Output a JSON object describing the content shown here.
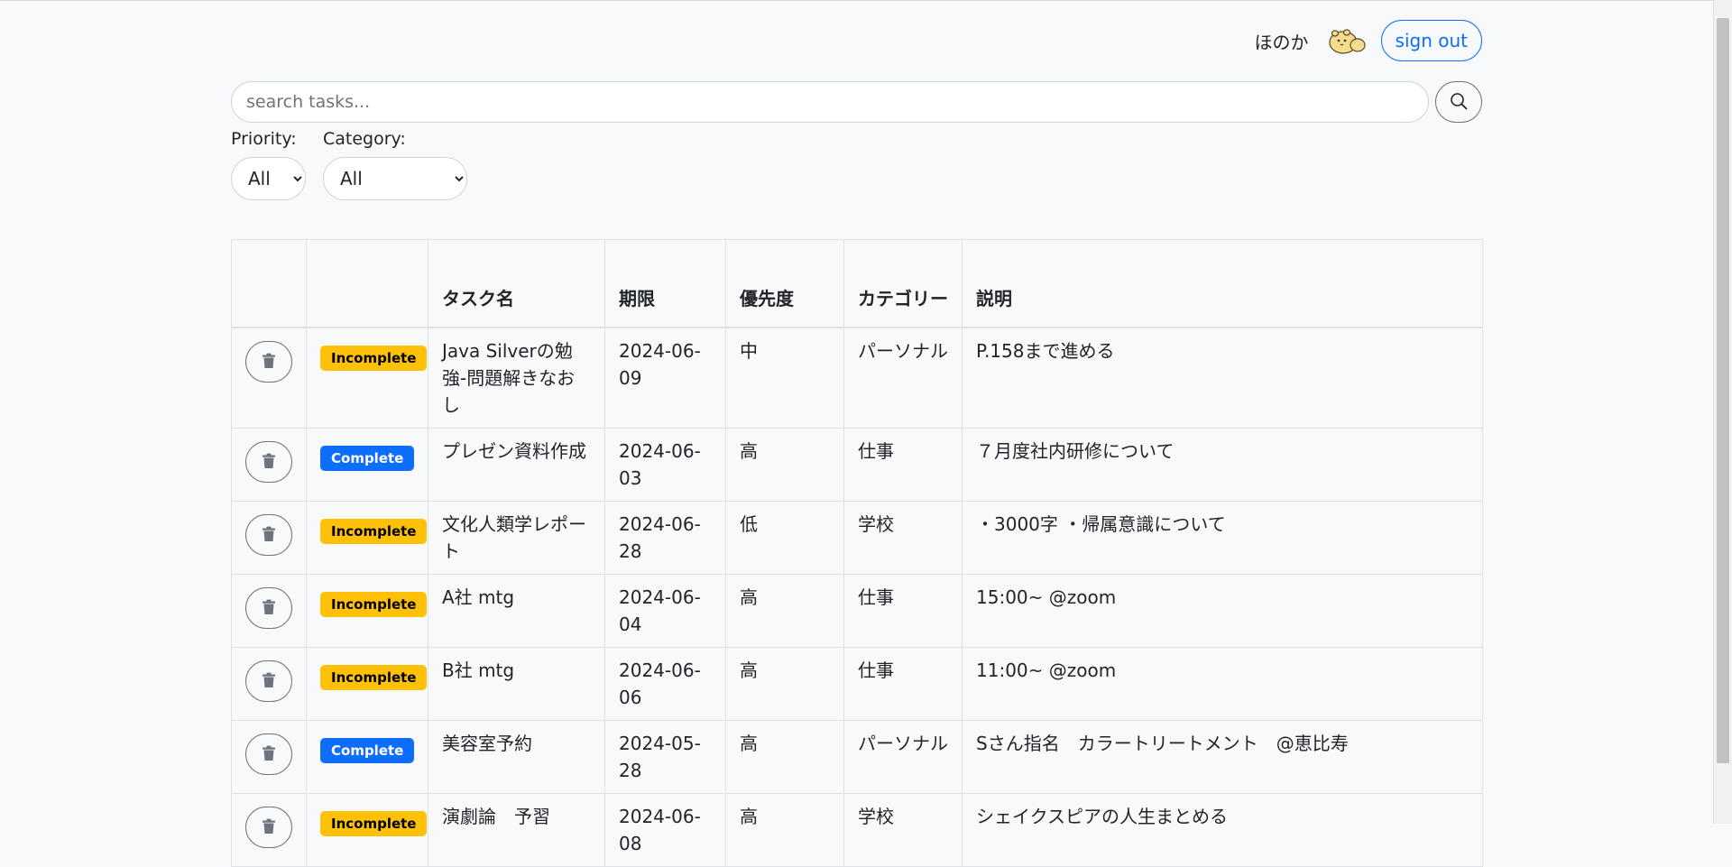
{
  "header": {
    "user_name": "ほのか",
    "avatar_icon": "hamster-avatar-icon",
    "sign_out_label": "sign out"
  },
  "search": {
    "placeholder": "search tasks...",
    "value": "",
    "button_icon": "search-icon"
  },
  "filters": {
    "priority": {
      "label": "Priority:",
      "selected": "All"
    },
    "category": {
      "label": "Category:",
      "selected": "All"
    }
  },
  "table": {
    "columns": [
      "",
      "",
      "タスク名",
      "期限",
      "優先度",
      "カテゴリー",
      "説明"
    ],
    "rows": [
      {
        "status": "Incomplete",
        "name": "Java Silverの勉強-問題解きなおし",
        "deadline": "2024-06-09",
        "priority": "中",
        "category": "パーソナル",
        "description": "P.158まで進める"
      },
      {
        "status": "Complete",
        "name": "プレゼン資料作成",
        "deadline": "2024-06-03",
        "priority": "高",
        "category": "仕事",
        "description": "７月度社内研修について"
      },
      {
        "status": "Incomplete",
        "name": "文化人類学レポート",
        "deadline": "2024-06-28",
        "priority": "低",
        "category": "学校",
        "description": "・3000字 ・帰属意識について"
      },
      {
        "status": "Incomplete",
        "name": "A社 mtg",
        "deadline": "2024-06-04",
        "priority": "高",
        "category": "仕事",
        "description": "15:00~ @zoom"
      },
      {
        "status": "Incomplete",
        "name": "B社 mtg",
        "deadline": "2024-06-06",
        "priority": "高",
        "category": "仕事",
        "description": "11:00~ @zoom"
      },
      {
        "status": "Complete",
        "name": "美容室予約",
        "deadline": "2024-05-28",
        "priority": "高",
        "category": "パーソナル",
        "description": "Sさん指名　カラートリートメント　@恵比寿"
      },
      {
        "status": "Incomplete",
        "name": "演劇論　予習",
        "deadline": "2024-06-08",
        "priority": "高",
        "category": "学校",
        "description": "シェイクスピアの人生まとめる"
      }
    ]
  },
  "colors": {
    "complete": "#0d6efd",
    "incomplete": "#ffc107",
    "background": "#f8f9fa"
  }
}
